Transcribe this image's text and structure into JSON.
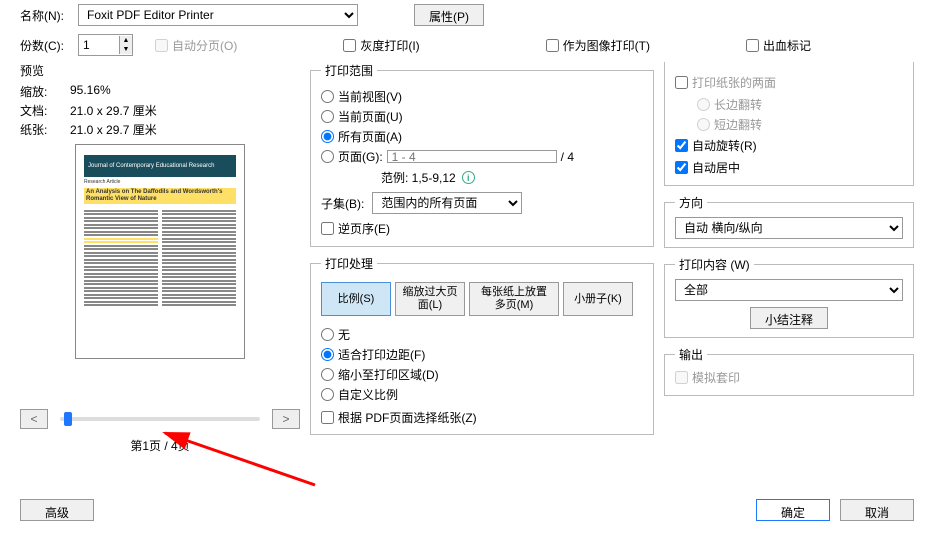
{
  "top": {
    "name_label": "名称(N):",
    "printer": "Foxit PDF Editor Printer",
    "properties_btn": "属性(P)",
    "copies_label": "份数(C):",
    "copies_value": "1",
    "collate": "自动分页(O)",
    "grayscale": "灰度打印(I)",
    "as_image": "作为图像打印(T)",
    "bleed": "出血标记"
  },
  "preview": {
    "title": "预览",
    "scale_label": "缩放:",
    "scale_value": "95.16%",
    "doc_label": "文档:",
    "doc_value": "21.0 x 29.7 厘米",
    "paper_label": "纸张:",
    "paper_value": "21.0 x 29.7 厘米",
    "page_indicator": "第1页 / 4页",
    "thumb_journal": "Journal of Contemporary Educational Research",
    "thumb_title": "An Analysis on The Daffodils and Wordsworth's Romantic View of Nature"
  },
  "range": {
    "title": "打印范围",
    "current_view": "当前视图(V)",
    "current_page": "当前页面(U)",
    "all_pages": "所有页面(A)",
    "pages_label": "页面(G):",
    "pages_placeholder": "1 - 4",
    "total_suffix": "/ 4",
    "range_hint_label": "范例: 1,5-9,12",
    "subset_label": "子集(B):",
    "subset_value": "范围内的所有页面",
    "reverse": "逆页序(E)"
  },
  "handling": {
    "title": "打印处理",
    "tab_scale": "比例(S)",
    "tab_shrink": "缩放过大页面(L)",
    "tab_multi": "每张纸上放置多页(M)",
    "tab_booklet": "小册子(K)",
    "opt_none": "无",
    "opt_fit": "适合打印边距(F)",
    "opt_shrink": "缩小至打印区域(D)",
    "opt_custom": "自定义比例",
    "by_pdf_size": "根据 PDF页面选择纸张(Z)"
  },
  "duplex": {
    "cb": "打印纸张的两面",
    "long_edge": "长边翻转",
    "short_edge": "短边翻转",
    "auto_rotate": "自动旋转(R)",
    "auto_center": "自动居中"
  },
  "orientation": {
    "title": "方向",
    "value": "自动 横向/纵向"
  },
  "content": {
    "title": "打印内容 (W)",
    "value": "全部",
    "summarize_btn": "小结注释"
  },
  "output": {
    "title": "输出",
    "simulate": "模拟套印"
  },
  "buttons": {
    "advanced": "高级",
    "ok": "确定",
    "cancel": "取消"
  }
}
